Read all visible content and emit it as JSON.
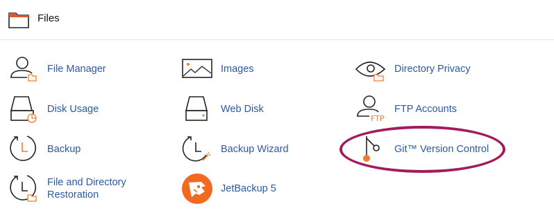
{
  "section": {
    "title": "Files",
    "icon": "folder-icon"
  },
  "items": [
    {
      "label": "File Manager",
      "icon": "file-manager-icon"
    },
    {
      "label": "Images",
      "icon": "images-icon"
    },
    {
      "label": "Directory Privacy",
      "icon": "directory-privacy-icon"
    },
    {
      "label": "Disk Usage",
      "icon": "disk-usage-icon"
    },
    {
      "label": "Web Disk",
      "icon": "web-disk-icon"
    },
    {
      "label": "FTP Accounts",
      "icon": "ftp-accounts-icon",
      "badge": "FTP"
    },
    {
      "label": "Backup",
      "icon": "backup-icon"
    },
    {
      "label": "Backup Wizard",
      "icon": "backup-wizard-icon"
    },
    {
      "label": "Git™ Version Control",
      "icon": "git-icon"
    },
    {
      "label_line1": "File and Directory",
      "label_line2": "Restoration",
      "icon": "file-restoration-icon"
    },
    {
      "label": "JetBackup 5",
      "icon": "jetbackup-icon"
    }
  ],
  "colors": {
    "link": "#2a5aa6",
    "accent": "#f07c30",
    "highlight": "#a11b5d"
  }
}
